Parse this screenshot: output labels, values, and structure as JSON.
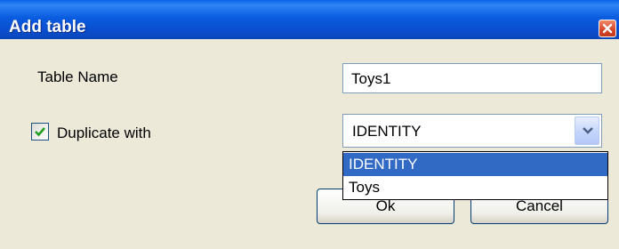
{
  "window": {
    "title": "Add table"
  },
  "form": {
    "table_name_label": "Table Name",
    "table_name_value": "Toys1",
    "duplicate_label": "Duplicate with",
    "duplicate_checked": true,
    "duplicate_selected": "IDENTITY",
    "duplicate_options": [
      "IDENTITY",
      "Toys"
    ]
  },
  "buttons": {
    "ok": "Ok",
    "cancel": "Cancel"
  },
  "icons": {
    "close": "close-icon",
    "check": "checkmark-icon",
    "dropdown": "chevron-down-icon"
  },
  "colors": {
    "titlebar": "#0a5ce0",
    "selection": "#316ac5",
    "face": "#ece9d8"
  }
}
